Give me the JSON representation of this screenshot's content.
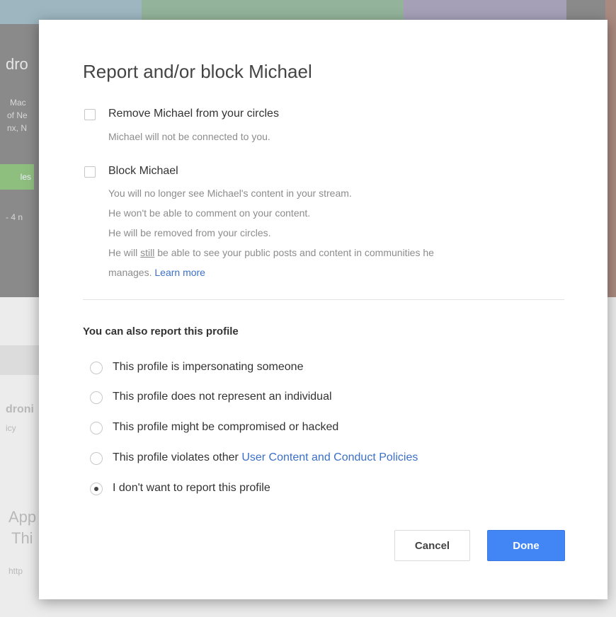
{
  "background": {
    "fragments": [
      "dro",
      "Mac",
      "of Ne",
      "nx, N",
      "les",
      "- 4 n",
      "droni",
      "icy",
      "App",
      "Thi",
      "http"
    ]
  },
  "dialog": {
    "title": "Report and/or block Michael",
    "remove_option": {
      "label": "Remove Michael from your circles",
      "description": "Michael will not be connected to you.",
      "checked": false
    },
    "block_option": {
      "label": "Block Michael",
      "lines": [
        "You will no longer see Michael's content in your stream.",
        "He won't be able to comment on your content.",
        "He will be removed from your circles."
      ],
      "last_line_prefix": "He will ",
      "last_line_underlined": "still",
      "last_line_suffix": " be able to see your public posts and content in communities he",
      "last_line_cont": "manages. ",
      "learn_more": "Learn more",
      "checked": false
    },
    "report_section_title": "You can also report this profile",
    "report_options": [
      {
        "label": "This profile is impersonating someone",
        "selected": false
      },
      {
        "label": "This profile does not represent an individual",
        "selected": false
      },
      {
        "label": "This profile might be compromised or hacked",
        "selected": false
      },
      {
        "label": "This profile violates other ",
        "link": "User Content and Conduct Policies",
        "selected": false
      },
      {
        "label": "I don't want to report this profile",
        "selected": true
      }
    ],
    "cancel_label": "Cancel",
    "done_label": "Done"
  },
  "colors": {
    "primary": "#4285f4",
    "link": "#3b70c7",
    "overlay": "#8a8a8a"
  }
}
